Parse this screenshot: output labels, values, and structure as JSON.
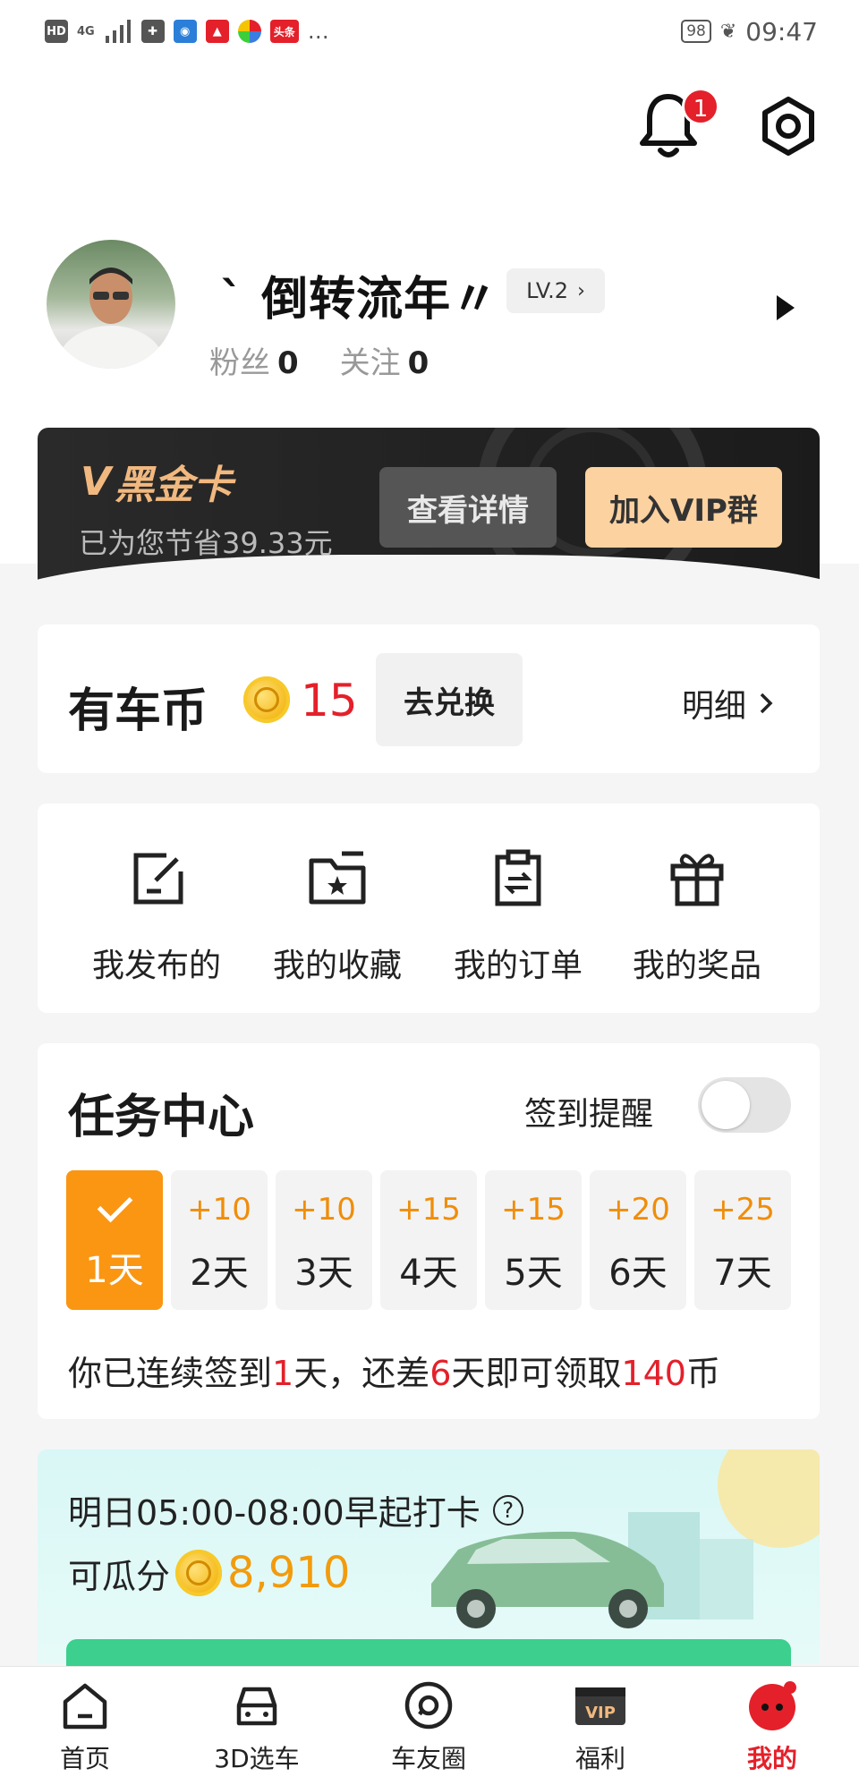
{
  "status_bar": {
    "left_icons": [
      "HD",
      "4G",
      "signal-icon",
      "app-icon",
      "app-icon",
      "app-icon",
      "app-icon",
      "头条",
      "…"
    ],
    "battery": "98",
    "time": "09:47"
  },
  "header": {
    "notification_count": "1",
    "username": "` 倒转流年〃",
    "level": "LV.2",
    "fans_label": "粉丝",
    "fans_count": "0",
    "follow_label": "关注",
    "follow_count": "0"
  },
  "vip_card": {
    "title": "黑金卡",
    "savings": "已为您节省39.33元",
    "detail_button": "查看详情",
    "join_button": "加入VIP群"
  },
  "coins": {
    "title": "有车币",
    "count": "15",
    "exchange_button": "去兑换",
    "detail_link": "明细"
  },
  "quick_actions": [
    {
      "label": "我发布的",
      "icon": "edit-icon"
    },
    {
      "label": "我的收藏",
      "icon": "folder-star-icon"
    },
    {
      "label": "我的订单",
      "icon": "clipboard-icon"
    },
    {
      "label": "我的奖品",
      "icon": "gift-icon"
    }
  ],
  "task_center": {
    "title": "任务中心",
    "remind_label": "签到提醒",
    "remind_on": false,
    "days": [
      {
        "bonus": "",
        "label": "1天",
        "checked": true
      },
      {
        "bonus": "+10",
        "label": "2天"
      },
      {
        "bonus": "+10",
        "label": "3天"
      },
      {
        "bonus": "+15",
        "label": "4天"
      },
      {
        "bonus": "+15",
        "label": "5天"
      },
      {
        "bonus": "+20",
        "label": "6天"
      },
      {
        "bonus": "+25",
        "label": "7天"
      }
    ],
    "streak": {
      "p1": "你已连续签到",
      "n1": "1",
      "p2": "天，还差",
      "n2": "6",
      "p3": "天即可领取",
      "n3": "140",
      "p4": "币"
    }
  },
  "early_checkin": {
    "title": "明日05:00-08:00早起打卡",
    "prefix": "可瓜分",
    "amount": "8,910"
  },
  "bottom_nav": [
    {
      "label": "首页",
      "icon": "home-icon"
    },
    {
      "label": "3D选车",
      "icon": "car-icon"
    },
    {
      "label": "车友圈",
      "icon": "circle-icon"
    },
    {
      "label": "福利",
      "icon": "vip-icon"
    },
    {
      "label": "我的",
      "icon": "profile-icon",
      "active": true
    }
  ],
  "colors": {
    "accent_red": "#e4202a",
    "accent_orange": "#fa9612",
    "vip_gold": "#f1b87f",
    "vip_join_bg": "#fbd2a0"
  }
}
